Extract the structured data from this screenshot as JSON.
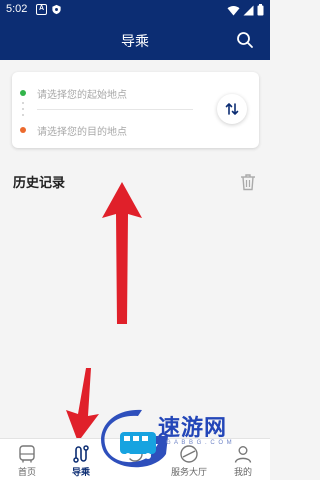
{
  "status_bar": {
    "time": "5:02",
    "notification_icons": [
      "a-icon",
      "shield-icon"
    ],
    "status_icons": [
      "wifi-icon",
      "signal-icon",
      "battery-icon"
    ]
  },
  "app_bar": {
    "title": "导乘",
    "action_icon": "search-icon"
  },
  "route_card": {
    "start_placeholder": "请选择您的起始地点",
    "end_placeholder": "请选择您的目的地点",
    "swap_icon": "swap-vertical-icon",
    "start_dot_color": "#32b44a",
    "end_dot_color": "#ec6a2e"
  },
  "history": {
    "title": "历史记录",
    "clear_icon": "trash-icon"
  },
  "tabs": [
    {
      "label": "首页",
      "icon": "bus-icon",
      "active": false
    },
    {
      "label": "导乘",
      "icon": "route-icon",
      "active": true
    },
    {
      "label": "",
      "icon": "center-icon",
      "active": false
    },
    {
      "label": "服务大厅",
      "icon": "service-icon",
      "active": false
    },
    {
      "label": "我的",
      "icon": "person-icon",
      "active": false
    }
  ],
  "watermark": {
    "text": "速游网",
    "subtext": "G A B B G . C O M"
  },
  "colors": {
    "primary": "#0c2d73",
    "annotation_arrow": "#e0202a"
  }
}
